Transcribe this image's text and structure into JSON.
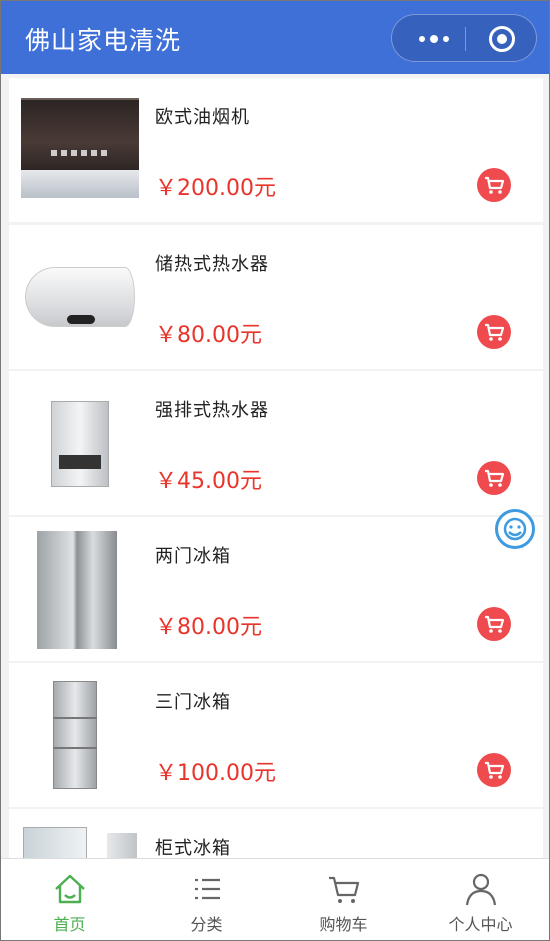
{
  "header": {
    "title": "佛山家电清洗"
  },
  "products": [
    {
      "name": "欧式油烟机",
      "price": "￥200.00元",
      "image_icon": "range-hood-image"
    },
    {
      "name": "储热式热水器",
      "price": "￥80.00元",
      "image_icon": "water-heater-image"
    },
    {
      "name": "强排式热水器",
      "price": "￥45.00元",
      "image_icon": "gas-water-heater-image"
    },
    {
      "name": "两门冰箱",
      "price": "￥80.00元",
      "image_icon": "two-door-fridge-image"
    },
    {
      "name": "三门冰箱",
      "price": "￥100.00元",
      "image_icon": "three-door-fridge-image"
    },
    {
      "name": "柜式冰箱",
      "price": "",
      "image_icon": "cabinet-fridge-image"
    }
  ],
  "tabs": [
    {
      "label": "首页",
      "icon": "home-icon",
      "active": true
    },
    {
      "label": "分类",
      "icon": "list-icon",
      "active": false
    },
    {
      "label": "购物车",
      "icon": "cart-icon",
      "active": false
    },
    {
      "label": "个人中心",
      "icon": "user-icon",
      "active": false
    }
  ],
  "colors": {
    "nav": "#3e70d8",
    "price": "#e8342a",
    "cart": "#ef4a4d",
    "active_tab": "#4caf50"
  }
}
